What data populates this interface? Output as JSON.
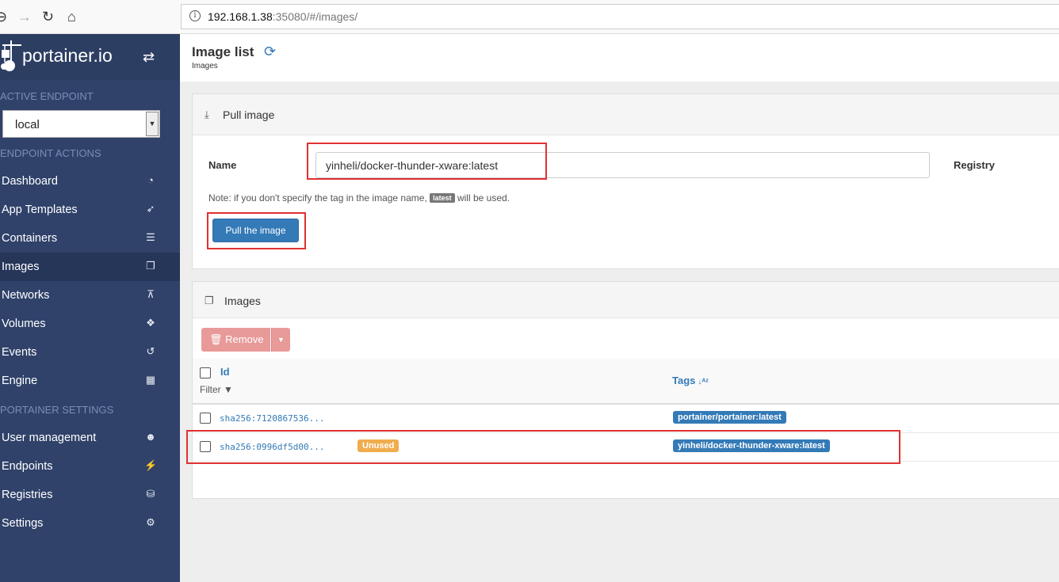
{
  "browser": {
    "url_host": "192.168.1.38",
    "url_rest": ":35080/#/images/"
  },
  "sidebar": {
    "brand": "portainer.io",
    "active_endpoint_title": "ACTIVE ENDPOINT",
    "endpoint_value": "local",
    "endpoint_actions_title": "ENDPOINT ACTIONS",
    "items": [
      {
        "label": "Dashboard",
        "icon": "tachometer-icon"
      },
      {
        "label": "App Templates",
        "icon": "rocket-icon"
      },
      {
        "label": "Containers",
        "icon": "server-icon"
      },
      {
        "label": "Images",
        "icon": "clone-icon"
      },
      {
        "label": "Networks",
        "icon": "sitemap-icon"
      },
      {
        "label": "Volumes",
        "icon": "cubes-icon"
      },
      {
        "label": "Events",
        "icon": "history-icon"
      },
      {
        "label": "Engine",
        "icon": "th-icon"
      }
    ],
    "settings_title": "PORTAINER SETTINGS",
    "settings_items": [
      {
        "label": "User management",
        "icon": "users-icon"
      },
      {
        "label": "Endpoints",
        "icon": "plug-icon"
      },
      {
        "label": "Registries",
        "icon": "database-icon"
      },
      {
        "label": "Settings",
        "icon": "cogs-icon"
      }
    ]
  },
  "header": {
    "title": "Image list",
    "breadcrumb": "Images"
  },
  "pull": {
    "panel_title": "Pull image",
    "name_label": "Name",
    "name_value": "yinheli/docker-thunder-xware:latest",
    "registry_label": "Registry",
    "note_before": "Note: if you don't specify the tag in the image name, ",
    "note_badge": "latest",
    "note_after": " will be used.",
    "button_label": "Pull the image"
  },
  "images": {
    "panel_title": "Images",
    "remove_label": "Remove",
    "col_id": "Id",
    "filter_label": "Filter",
    "col_tags": "Tags",
    "rows": [
      {
        "id": "sha256:7120867536...",
        "unused": "",
        "tag": "portainer/portainer:latest"
      },
      {
        "id": "sha256:0996df5d00...",
        "unused": "Unused",
        "tag": "yinheli/docker-thunder-xware:latest"
      }
    ]
  },
  "colors": {
    "sidebar_bg": "#30426a",
    "primary": "#337ab7",
    "danger_light": "#e89a98",
    "warning": "#f0ad4e",
    "annotation_red": "#e03131"
  }
}
